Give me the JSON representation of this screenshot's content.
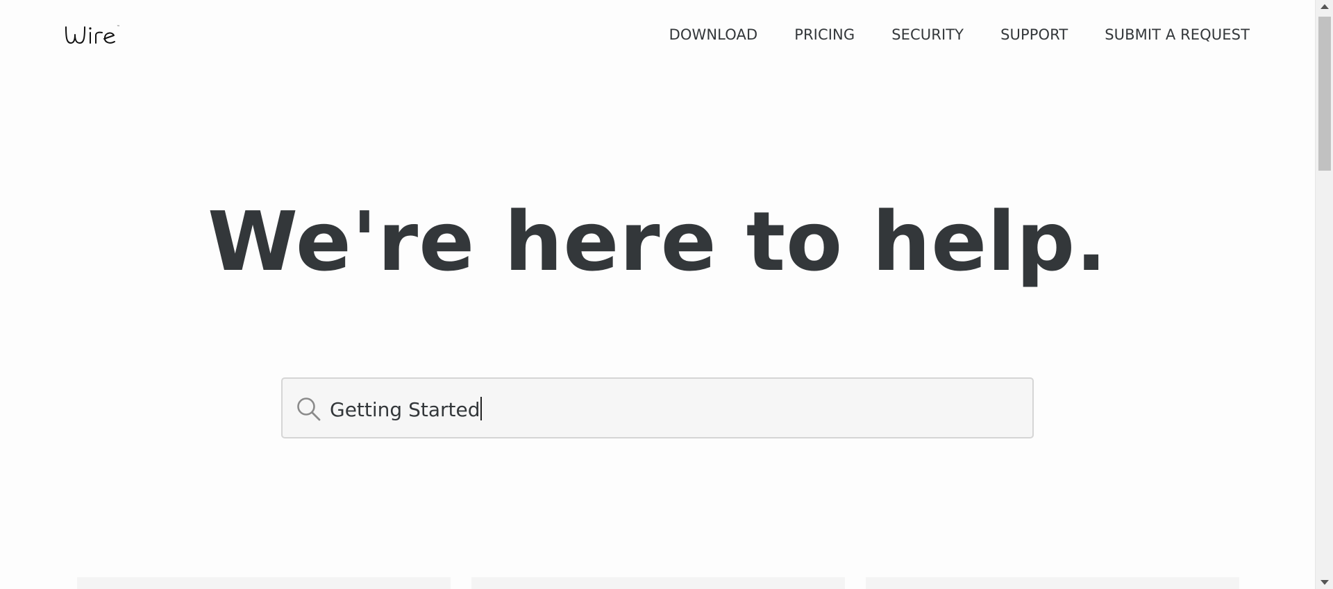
{
  "header": {
    "logo_text": "wire",
    "nav": [
      {
        "label": "DOWNLOAD"
      },
      {
        "label": "PRICING"
      },
      {
        "label": "SECURITY"
      },
      {
        "label": "SUPPORT"
      },
      {
        "label": "SUBMIT A REQUEST"
      }
    ]
  },
  "hero": {
    "title": "We're here to help."
  },
  "search": {
    "value": "Getting Started",
    "icon": "search-icon"
  },
  "colors": {
    "text": "#33373a",
    "background": "#fdfdfd",
    "search_background": "#f6f6f6",
    "search_border": "#d5d5d5"
  }
}
